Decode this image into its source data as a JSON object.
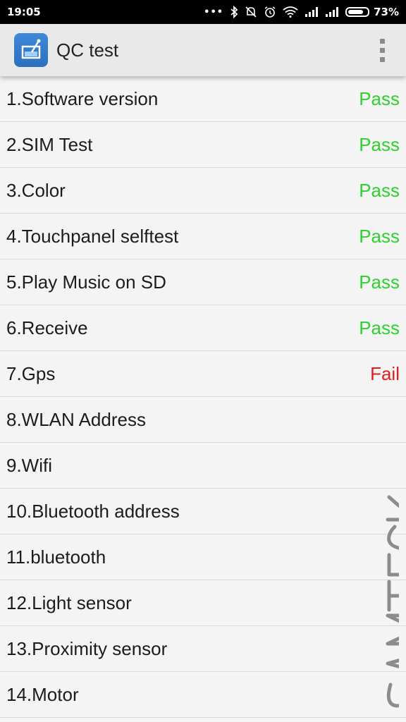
{
  "status_bar": {
    "time": "19:05",
    "dots": "•••",
    "battery": "73%",
    "battery_level": 0.73,
    "icons": [
      "bluetooth-icon",
      "mute-icon",
      "alarm-icon",
      "wifi-icon",
      "signal-icon",
      "signal-icon",
      "battery-icon"
    ]
  },
  "app_bar": {
    "title": "QC test",
    "app_icon": "qc-test-app-icon",
    "menu_icon": "overflow-menu-icon"
  },
  "tests": [
    {
      "label": "1.Software version",
      "status": "Pass"
    },
    {
      "label": "2.SIM Test",
      "status": "Pass"
    },
    {
      "label": "3.Color",
      "status": "Pass"
    },
    {
      "label": "4.Touchpanel selftest",
      "status": "Pass"
    },
    {
      "label": "5.Play Music on SD",
      "status": "Pass"
    },
    {
      "label": "6.Receive",
      "status": "Pass"
    },
    {
      "label": "7.Gps",
      "status": "Fail"
    },
    {
      "label": "8.WLAN Address",
      "status": ""
    },
    {
      "label": "9.Wifi",
      "status": ""
    },
    {
      "label": "10.Bluetooth address",
      "status": ""
    },
    {
      "label": "11.bluetooth",
      "status": ""
    },
    {
      "label": "12.Light sensor",
      "status": ""
    },
    {
      "label": "13.Proximity sensor",
      "status": ""
    },
    {
      "label": "14.Motor",
      "status": ""
    }
  ],
  "colors": {
    "pass": "#2fd12f",
    "fail": "#e21d1d",
    "watermark": "#8c8c8c"
  },
  "watermark_text": "SAMTECK"
}
